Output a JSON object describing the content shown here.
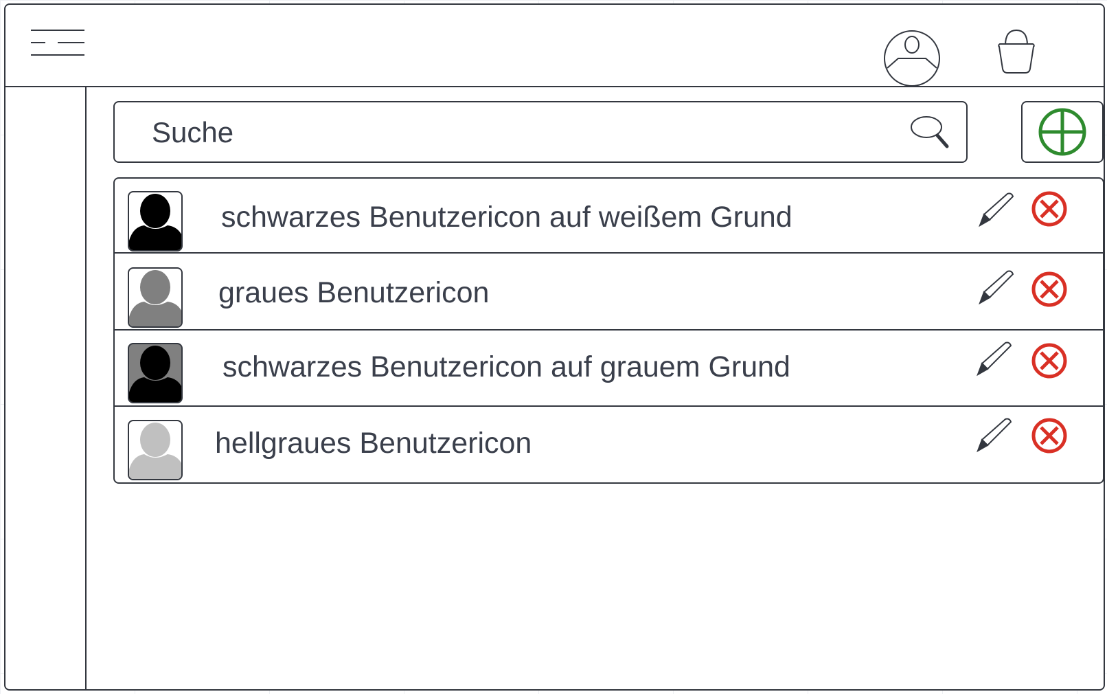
{
  "header": {
    "menu_icon": "hamburger-menu-icon",
    "account_icon": "user-circle-icon",
    "bag_icon": "shopping-bag-icon"
  },
  "search": {
    "placeholder": "Suche",
    "icon": "magnifier-icon"
  },
  "add_button": {
    "icon": "plus-circle-icon",
    "color": "#2e8b2e"
  },
  "users": [
    {
      "label": "schwarzes Benutzericon auf weißem Grund",
      "avatar_bg": "#ffffff",
      "avatar_fg": "#000000"
    },
    {
      "label": "graues Benutzericon",
      "avatar_bg": "#ffffff",
      "avatar_fg": "#808080"
    },
    {
      "label": "schwarzes Benutzericon auf grauem Grund",
      "avatar_bg": "#808080",
      "avatar_fg": "#000000"
    },
    {
      "label": "hellgraues Benutzericon",
      "avatar_bg": "#ffffff",
      "avatar_fg": "#c0c0c0"
    }
  ],
  "row_actions": {
    "edit_icon": "pencil-icon",
    "delete_icon": "delete-circle-x-icon",
    "delete_color": "#d93025"
  }
}
